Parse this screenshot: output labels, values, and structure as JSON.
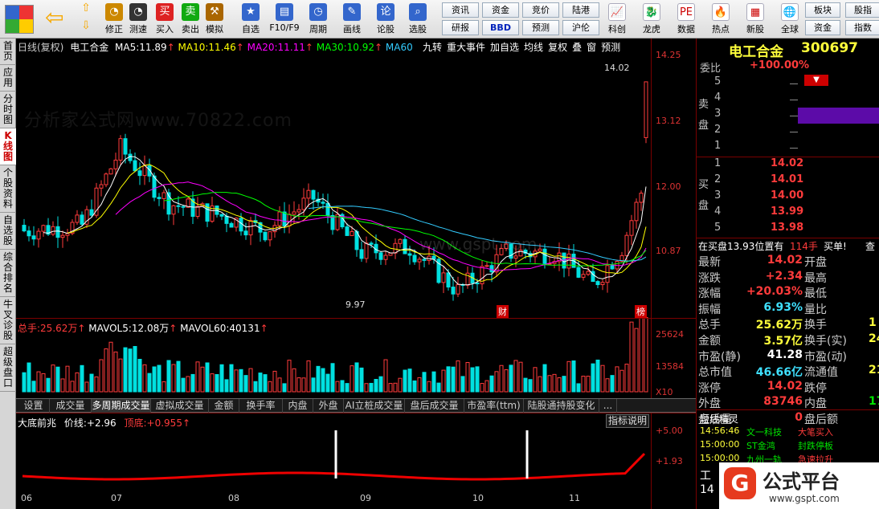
{
  "toolbar": {
    "row1": [
      {
        "label": "买入",
        "icon": "buy-icon",
        "color": "#d22"
      },
      {
        "label": "卖出",
        "icon": "sell-icon",
        "color": "#1a1"
      },
      {
        "label": "模拟",
        "icon": "hammer-icon",
        "color": "#a60"
      },
      {
        "label": "自选",
        "icon": "star-icon",
        "color": "#36c"
      },
      {
        "label": "F10/F9",
        "icon": "f10-icon",
        "color": "#36c"
      },
      {
        "label": "周期",
        "icon": "clock-icon",
        "color": "#36c"
      },
      {
        "label": "画线",
        "icon": "pencil-icon",
        "color": "#36c"
      },
      {
        "label": "论股",
        "icon": "comment-icon",
        "color": "#36c"
      },
      {
        "label": "选股",
        "icon": "search-icon",
        "color": "#36c"
      }
    ],
    "row0": [
      {
        "label": "修正",
        "icon": "revise-icon",
        "color": "#c80"
      },
      {
        "label": "测速",
        "icon": "speed-icon",
        "color": "#333"
      }
    ],
    "small": [
      [
        "资讯",
        "资金",
        "竞价",
        "陆港"
      ],
      [
        "研报",
        "BBD",
        "预测",
        "沪伦"
      ]
    ],
    "right": [
      {
        "label": "科创",
        "icon": "chart-icon"
      },
      {
        "label": "龙虎",
        "icon": "dragon-icon"
      },
      {
        "label": "数据",
        "icon": "pe-icon"
      },
      {
        "label": "热点",
        "icon": "fire-icon"
      },
      {
        "label": "新股",
        "icon": "new-icon"
      },
      {
        "label": "全球",
        "icon": "globe-icon"
      }
    ],
    "far": [
      [
        "板块",
        "股指"
      ],
      [
        "资金",
        "指数"
      ]
    ]
  },
  "sidebar": [
    "首页",
    "应用",
    "分时图",
    "K线图",
    "个股资料",
    "自选股",
    "综合排名",
    "牛叉诊股",
    "超级盘口"
  ],
  "header": {
    "title": "日线(复权)",
    "stock": "电工合金",
    "ma5_label": "MA5:",
    "ma5": "11.89",
    "ma10_label": "MA10:",
    "ma10": "11.46",
    "ma20_label": "MA20:",
    "ma20": "11.11",
    "ma30_label": "MA30:",
    "ma30": "10.92",
    "ma60_label": "MA60",
    "buttons": [
      "九转",
      "重大事件",
      "加自选",
      "均线",
      "复权",
      "叠",
      "窗",
      "预测"
    ]
  },
  "price_axis": [
    "14.25",
    "13.12",
    "12.00",
    "10.87"
  ],
  "annot": {
    "high": "14.02",
    "low": "9.97",
    "cai": "财",
    "bang": "榜"
  },
  "volume": {
    "total_label": "总手:",
    "total": "25.62万",
    "mavol5_label": "MAVOL5:",
    "mavol5": "12.08万",
    "mavol60_label": "MAVOL60:",
    "mavol60": "40131",
    "axis": [
      "25624",
      "13584",
      "X10"
    ]
  },
  "tabs": [
    "设置",
    "成交量",
    "多周期成交量",
    "虚拟成交量",
    "金额",
    "换手率",
    "内盘",
    "外盘",
    "AI立桩成交量",
    "盘后成交量",
    "市盈率(ttm)",
    "陆股通持股变化",
    "..."
  ],
  "indicator": {
    "name": "大底前兆",
    "price_label": "价线:",
    "price": "+2.96",
    "bottom_label": "顶底:",
    "bottom": "+0.955",
    "btn": "指标说明",
    "axis": [
      "+5.00",
      "+1.93"
    ]
  },
  "months": [
    "06",
    "07",
    "08",
    "09",
    "10",
    "11"
  ],
  "watermarks": [
    "分析家公式网www.70822.com",
    "www.gspt.com"
  ],
  "quote": {
    "name": "电工合金",
    "code": "300697",
    "weibi_label": "委比",
    "weibi": "+100.00%",
    "sell_label": "卖盘",
    "buy_label": "买盘",
    "sell": [
      {
        "n": "5",
        "p": ""
      },
      {
        "n": "4",
        "p": ""
      },
      {
        "n": "3",
        "p": ""
      },
      {
        "n": "2",
        "p": ""
      },
      {
        "n": "1",
        "p": ""
      }
    ],
    "buy": [
      {
        "n": "1",
        "p": "14.02"
      },
      {
        "n": "2",
        "p": "14.01"
      },
      {
        "n": "3",
        "p": "14.00"
      },
      {
        "n": "4",
        "p": "13.99"
      },
      {
        "n": "5",
        "p": "13.98"
      }
    ],
    "queue": "在买盘13.93位置有",
    "queue_vol": "114手",
    "queue_btn": "买单!",
    "queue_more": "查",
    "stats": [
      [
        "最新",
        "14.02",
        "开盘",
        ""
      ],
      [
        "涨跌",
        "+2.34",
        "最高",
        ""
      ],
      [
        "涨幅",
        "+20.03%",
        "最低",
        ""
      ],
      [
        "振幅",
        "6.93%",
        "量比",
        ""
      ],
      [
        "总手",
        "25.62万",
        "换手",
        "1"
      ],
      [
        "金额",
        "3.57亿",
        "换手(实)",
        "24"
      ],
      [
        "市盈(静)",
        "41.28",
        "市盈(动)",
        ""
      ],
      [
        "总市值",
        "46.66亿",
        "流通值",
        "21"
      ],
      [
        "涨停",
        "14.02",
        "跌停",
        ""
      ],
      [
        "外盘",
        "83746",
        "内盘",
        "17"
      ],
      [
        "盘后量",
        "0",
        "盘后额",
        ""
      ]
    ],
    "news_title": "短线精灵",
    "news": [
      [
        "14:56:46",
        "文一科技",
        "大笔买入"
      ],
      [
        "15:00:00",
        "ST金鸿",
        "封跌停板"
      ],
      [
        "15:00:00",
        "九州一轨",
        "急速拉升"
      ]
    ],
    "extra": [
      "工",
      "14"
    ],
    "logo": "公式平台",
    "logo_url": "www.gspt.com"
  }
}
